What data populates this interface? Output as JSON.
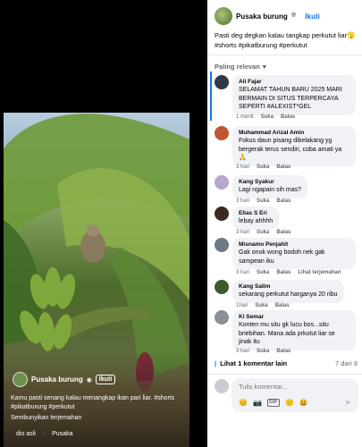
{
  "video": {
    "channel_name": "Pusaka burung",
    "badge_icon": "globe-icon",
    "follow_label": "Ikuti",
    "caption": "Kamu pasti senang kalau menangkap ikan pari liar. #shorts #pikatburung #perkutut",
    "hide_translation": "Sembunyikan terjemahan",
    "bottom_items": [
      "dio asli",
      "Pusaka"
    ]
  },
  "post": {
    "author": "Pusaka burung",
    "privacy_icon": "globe-icon",
    "follow_label": "Ikuti",
    "description": "Pasti deg degkan kalau tangkap perkutut liar🫣 #shorts #pikatburung #perkutut",
    "sort_label": "Paling relevan"
  },
  "comments": [
    {
      "author": "Ali Fajar",
      "text": "SELAMAT TAHUN BARU 2025 MARI BERMAIN DI SITUS TERPERCAYA SEPERTI #ALEXIST*GEL",
      "time": "1 menit",
      "like": "Suka",
      "reply": "Balas",
      "extra": ""
    },
    {
      "author": "Muhammad Arizal Amin",
      "text": "Fokus daun pisang dibelakang yg bergerak terus sendiri, coba amati ya 🙏",
      "time": "3 hari",
      "like": "Suka",
      "reply": "Balas",
      "extra": ""
    },
    {
      "author": "Kang Syakur",
      "text": "Lagi ngapain sih mas?",
      "time": "3 hari",
      "like": "Suka",
      "reply": "Balas",
      "extra": ""
    },
    {
      "author": "Elias S Eri",
      "text": "lebay ahhhh",
      "time": "3 hari",
      "like": "Suka",
      "reply": "Balas",
      "extra": ""
    },
    {
      "author": "Misnamo Penjahit",
      "text": "Gak onok wong bodoh nek gak sampean iku",
      "time": "3 hari",
      "like": "Suka",
      "reply": "Balas",
      "extra": "Lihat terjemahan"
    },
    {
      "author": "Kang Salim",
      "text": "sekarang perkutut harganya 20 ribu",
      "time": "1hari",
      "like": "Suka",
      "reply": "Balas",
      "extra": ""
    },
    {
      "author": "Ki Semar",
      "text": "Konten mu situ gk lucu bos...situ briebihan. Mana ada prkutut liar se jinak itu",
      "time": "3 hari",
      "like": "Suka",
      "reply": "Balas",
      "extra": ""
    }
  ],
  "more_replies": {
    "label": "Lihat 1 komentar lain",
    "count": "7 dari 8"
  },
  "composer": {
    "placeholder": "Tulis komentar...",
    "tools": [
      "😊",
      "📷",
      "GIF",
      "🙂",
      "😃"
    ],
    "send_icon": "send-icon"
  },
  "colors": {
    "accent": "#1b74e4",
    "panel_bg": "#ffffff",
    "bubble_bg": "#f0f2f5",
    "muted_text": "#65676b"
  }
}
